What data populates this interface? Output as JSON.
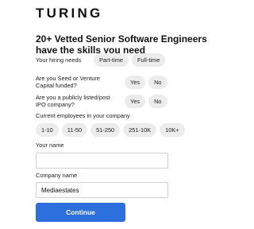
{
  "brand": {
    "logo_text": "TURING"
  },
  "headline": "20+ Vetted Senior Software Engineers have the skills you need",
  "form": {
    "hiring_needs": {
      "label": "Your hiring needs",
      "options": [
        "Part-time",
        "Full-time"
      ]
    },
    "vc_funded": {
      "label": "Are you Seed or Venture Capital funded?",
      "options": [
        "Yes",
        "No"
      ]
    },
    "public_company": {
      "label": "Are you a publicly listed/post IPO company?",
      "options": [
        "Yes",
        "No"
      ]
    },
    "employees": {
      "label": "Current employees in your company",
      "options": [
        "1-10",
        "11-50",
        "51-250",
        "251-10K",
        "10K+"
      ]
    },
    "your_name": {
      "label": "Your name",
      "value": ""
    },
    "company_name": {
      "label": "Company name",
      "value": "Mediaestates"
    },
    "submit_label": "Continue"
  },
  "colors": {
    "accent": "#2d6fdc",
    "chip_bg": "#ececec"
  }
}
